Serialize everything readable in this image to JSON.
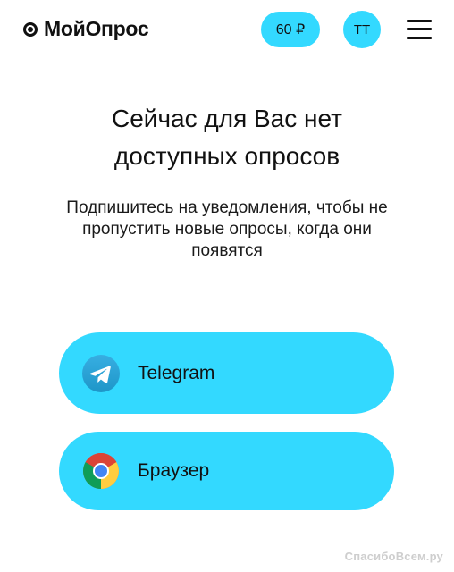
{
  "header": {
    "logo_text": "МойОпрос",
    "balance": "60 ₽",
    "avatar_initials": "ТТ",
    "menu_icon": "hamburger-menu-icon"
  },
  "main": {
    "title_lines": [
      "Сейчас для Вас нет",
      "доступных опросов"
    ],
    "subtitle_lines": [
      "Подпишитесь на уведомления, чтобы не",
      "пропустить новые опросы, когда они",
      "появятся"
    ]
  },
  "options": [
    {
      "label": "Telegram",
      "icon": "telegram-icon"
    },
    {
      "label": "Браузер",
      "icon": "chrome-icon"
    }
  ],
  "watermark": "СпасибоВсем.ру",
  "colors": {
    "accent": "#33d9ff",
    "text": "#111111",
    "telegram_blue": "#2aa3e6"
  }
}
